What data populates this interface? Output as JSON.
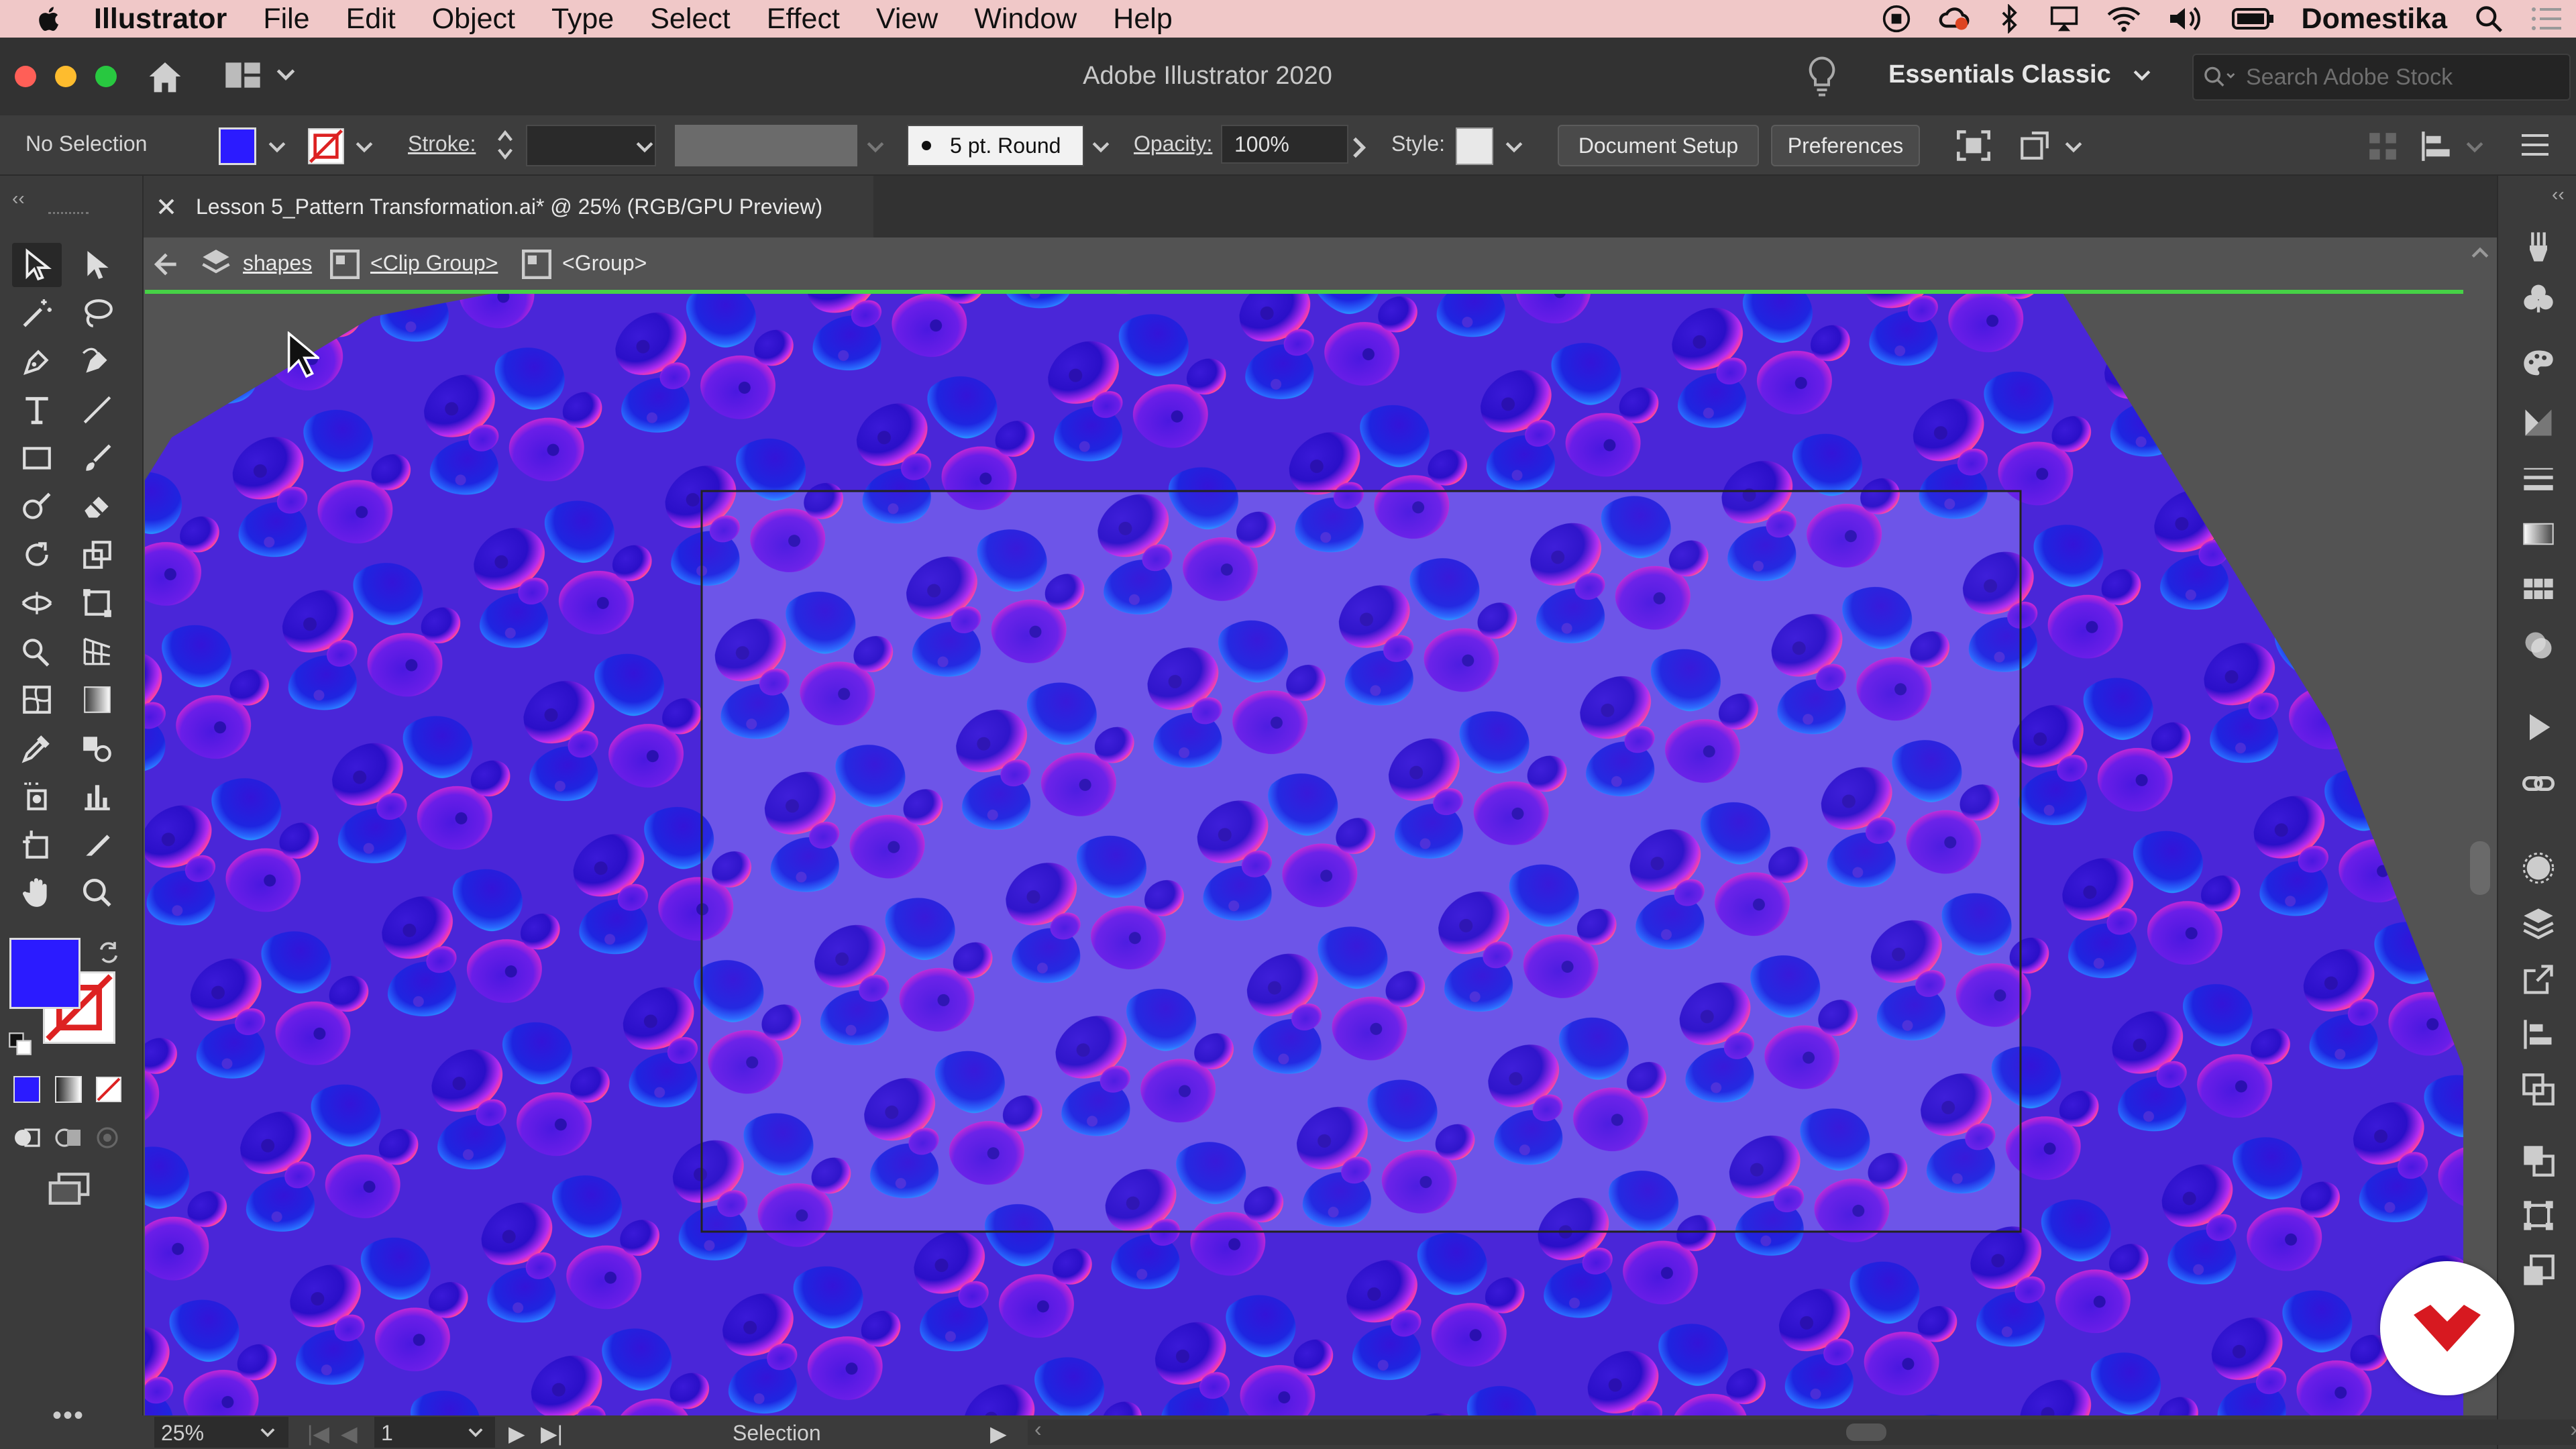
{
  "menubar": {
    "app_name": "Illustrator",
    "items": [
      "File",
      "Edit",
      "Object",
      "Type",
      "Select",
      "Effect",
      "View",
      "Window",
      "Help"
    ],
    "user": "Domestika"
  },
  "titlebar": {
    "title": "Adobe Illustrator 2020",
    "workspace": "Essentials Classic",
    "search_placeholder": "Search Adobe Stock"
  },
  "control": {
    "selection": "No Selection",
    "stroke_label": "Stroke:",
    "brush": "5 pt. Round",
    "opacity_label": "Opacity:",
    "opacity_value": "100%",
    "style_label": "Style:",
    "document_setup": "Document Setup",
    "preferences": "Preferences",
    "fill_color": "#2b1bff"
  },
  "document": {
    "tab_title": "Lesson 5_Pattern Transformation.ai* @ 25% (RGB/GPU Preview)"
  },
  "breadcrumb": {
    "items": [
      "shapes",
      "<Clip Group>",
      "<Group>"
    ]
  },
  "status": {
    "zoom": "25%",
    "artboard": "1",
    "tool": "Selection"
  },
  "colors": {
    "fill": "#2b1bff",
    "artboard_bg": "#8a7cf5",
    "selection_line": "#46d246"
  }
}
